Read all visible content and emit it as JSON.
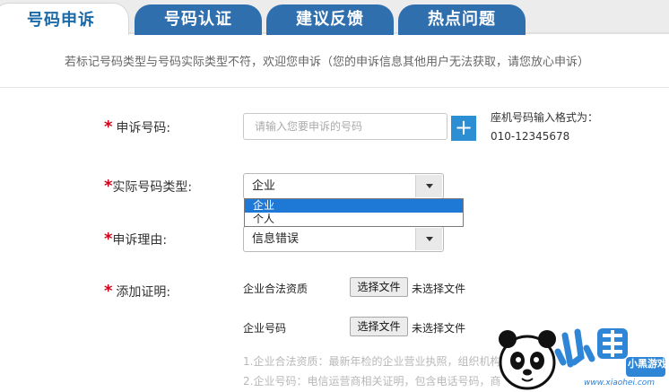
{
  "tabs": [
    {
      "label": "号码申诉",
      "active": true
    },
    {
      "label": "号码认证",
      "active": false
    },
    {
      "label": "建议反馈",
      "active": false
    },
    {
      "label": "热点问题",
      "active": false
    }
  ],
  "notice": "若标记号码类型与号码实际类型不符，欢迎您申诉（您的申诉信息其他用户无法获取，请您放心申诉）",
  "form": {
    "required_mark": "*",
    "phone": {
      "label": "申诉号码:",
      "placeholder": "请输入您要申诉的号码",
      "add_button": "+",
      "hint_line1": "座机号码输入格式为：",
      "hint_line2": "010-12345678"
    },
    "type": {
      "label": "实际号码类型:",
      "value": "企业",
      "options": [
        "企业",
        "个人"
      ],
      "highlighted_option": "企业"
    },
    "reason": {
      "label": "申诉理由:",
      "value": "信息错误"
    },
    "evidence": {
      "label": "添加证明:",
      "items": [
        {
          "name": "企业合法资质",
          "button": "选择文件",
          "status": "未选择文件"
        },
        {
          "name": "企业号码",
          "button": "选择文件",
          "status": "未选择文件"
        }
      ],
      "notes": [
        "1.企业合法资质：最新年检的企业营业执照，组织机构",
        "2.企业号码：电信运营商相关证明，包含电话号码，商"
      ]
    }
  },
  "watermark": {
    "logo_text": "小黑游戏",
    "url": "www.xiaohei.com"
  },
  "colors": {
    "tab_blue": "#2f6fae",
    "active_tab_text": "#1b6aa8",
    "required_red": "#d0021b",
    "plus_button": "#2c8fd3",
    "dropdown_highlight": "#1e79d6"
  }
}
